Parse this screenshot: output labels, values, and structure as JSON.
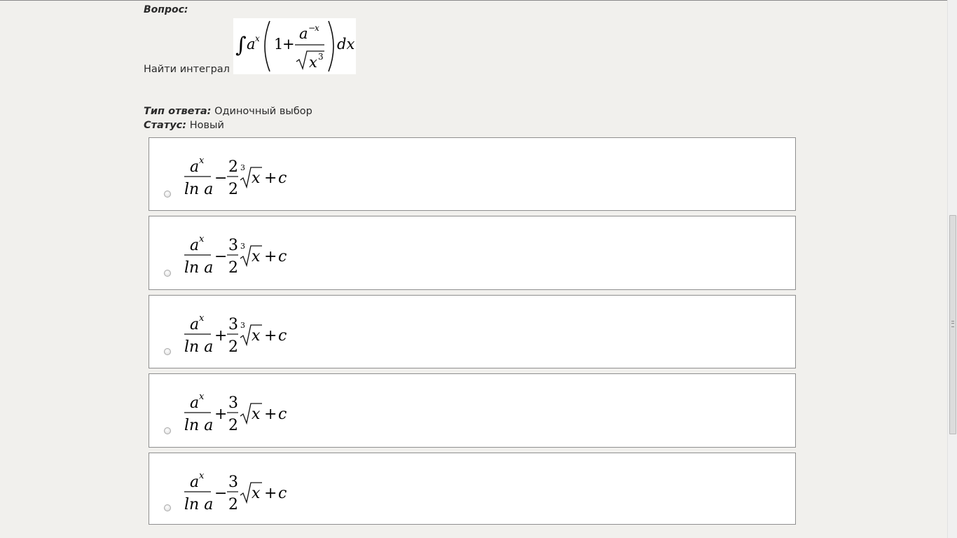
{
  "question": {
    "label": "Вопрос:",
    "text": "Найти интеграл"
  },
  "answer_type": {
    "label": "Тип ответа:",
    "value": "Одиночный выбор"
  },
  "status": {
    "label": "Статус:",
    "value": "Новый"
  },
  "options": [
    {
      "sign": "−",
      "numerator": "2",
      "root_index": "3"
    },
    {
      "sign": "−",
      "numerator": "3",
      "root_index": "3"
    },
    {
      "sign": "+",
      "numerator": "3",
      "root_index": "3"
    },
    {
      "sign": "+",
      "numerator": "3",
      "root_index": ""
    },
    {
      "sign": "−",
      "numerator": "3",
      "root_index": ""
    }
  ]
}
